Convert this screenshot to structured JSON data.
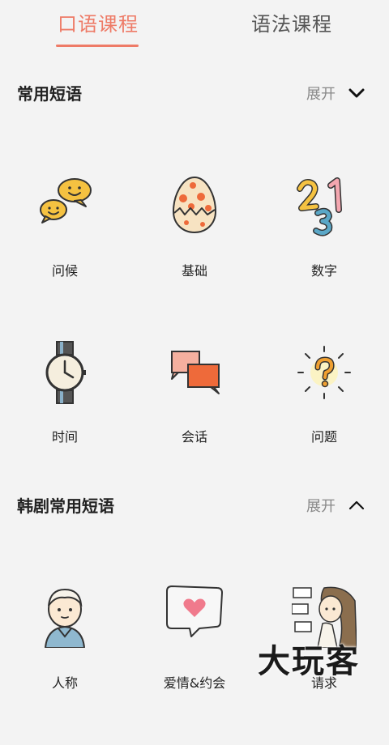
{
  "tabs": {
    "oral": "口语课程",
    "grammar": "语法课程"
  },
  "section1": {
    "title": "常用短语",
    "expand_label": "展开",
    "items": [
      "问候",
      "基础",
      "数字",
      "时间",
      "会话",
      "问题"
    ]
  },
  "section2": {
    "title": "韩剧常用短语",
    "expand_label": "展开",
    "items": [
      "人称",
      "爱情&约会",
      "请求"
    ]
  },
  "watermark": "大玩客",
  "colors": {
    "accent": "#ee7b67",
    "background": "#f3f3f3"
  },
  "icons": {
    "s1": [
      "chat-bubbles-icon",
      "easter-egg-icon",
      "numbers-icon",
      "watch-icon",
      "dialogue-squares-icon",
      "question-bulb-icon"
    ],
    "s2": [
      "boy-avatar-icon",
      "love-message-icon",
      "girl-thinking-icon"
    ]
  }
}
